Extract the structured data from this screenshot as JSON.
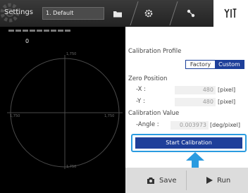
{
  "header": {
    "title": "Settings",
    "profile_select": "1. Default"
  },
  "icons": {
    "folder": "folder-icon",
    "settings": "gear-icon",
    "network": "network-icon",
    "calibration_tab": "calibration-icon"
  },
  "view": {
    "count": "0",
    "tick_top": "1,750",
    "tick_left": "1,750",
    "tick_right": "1,750",
    "tick_bottom": "1,750"
  },
  "panel": {
    "calibration_profile_label": "Calibration Profile",
    "profile_options": [
      "Factory",
      "Custom"
    ],
    "selected_profile": "Custom",
    "zero_position_label": "Zero Position",
    "x_label": "-X  :",
    "x_value": "480",
    "x_unit": "[pixel]",
    "y_label": "-Y  :",
    "y_value": "480",
    "y_unit": "[pixel]",
    "calibration_value_label": "Calibration Value",
    "angle_label": "-Angle  :",
    "angle_value": "0.003973",
    "angle_unit": "[deg/pixel]",
    "start_button": "Start Calibration"
  },
  "footer": {
    "save_label": "Save",
    "run_label": "Run"
  },
  "colors": {
    "accent": "#1e3f9a",
    "highlight": "#2a9be0"
  }
}
